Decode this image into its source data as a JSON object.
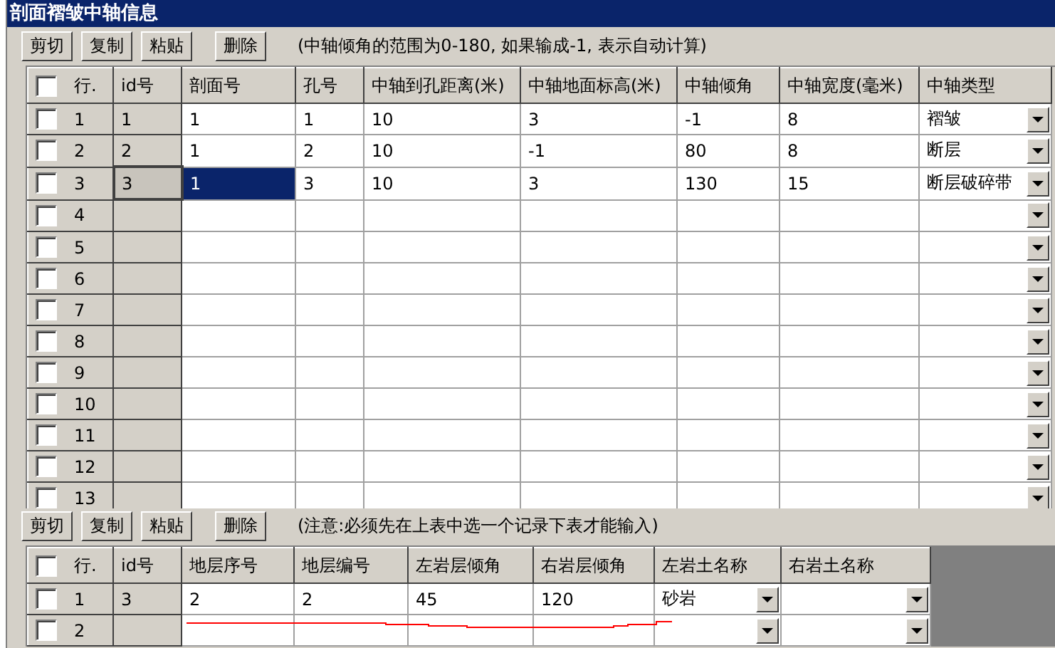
{
  "window": {
    "title": "剖面褶皱中轴信息"
  },
  "toolbar_top": {
    "buttons": [
      "剪切",
      "复制",
      "粘贴",
      "删除"
    ],
    "note": "(中轴倾角的范围为0-180, 如果输成-1, 表示自动计算)"
  },
  "axis_table": {
    "header_checked": false,
    "columns": [
      "行.",
      "id号",
      "剖面号",
      "孔号",
      "中轴到孔距离(米)",
      "中轴地面标高(米)",
      "中轴倾角",
      "中轴宽度(毫米)",
      "中轴类型"
    ],
    "rows": [
      {
        "cells": [
          "1",
          "1",
          "1",
          "1",
          "10",
          "3",
          "-1",
          "8",
          "褶皱"
        ],
        "checked": false,
        "selected": false
      },
      {
        "cells": [
          "2",
          "2",
          "1",
          "2",
          "10",
          "-1",
          "80",
          "8",
          "断层"
        ],
        "checked": false,
        "selected": false
      },
      {
        "cells": [
          "3",
          "3",
          "1",
          "3",
          "10",
          "3",
          "130",
          "15",
          "断层破碎带"
        ],
        "checked": false,
        "selected": true
      },
      {
        "cells": [
          "4",
          "",
          "",
          "",
          "",
          "",
          "",
          "",
          ""
        ],
        "checked": false,
        "selected": false
      },
      {
        "cells": [
          "5",
          "",
          "",
          "",
          "",
          "",
          "",
          "",
          ""
        ],
        "checked": false,
        "selected": false
      },
      {
        "cells": [
          "6",
          "",
          "",
          "",
          "",
          "",
          "",
          "",
          ""
        ],
        "checked": false,
        "selected": false
      },
      {
        "cells": [
          "7",
          "",
          "",
          "",
          "",
          "",
          "",
          "",
          ""
        ],
        "checked": false,
        "selected": false
      },
      {
        "cells": [
          "8",
          "",
          "",
          "",
          "",
          "",
          "",
          "",
          ""
        ],
        "checked": false,
        "selected": false
      },
      {
        "cells": [
          "9",
          "",
          "",
          "",
          "",
          "",
          "",
          "",
          ""
        ],
        "checked": false,
        "selected": false
      },
      {
        "cells": [
          "10",
          "",
          "",
          "",
          "",
          "",
          "",
          "",
          ""
        ],
        "checked": false,
        "selected": false
      },
      {
        "cells": [
          "11",
          "",
          "",
          "",
          "",
          "",
          "",
          "",
          ""
        ],
        "checked": false,
        "selected": false
      },
      {
        "cells": [
          "12",
          "",
          "",
          "",
          "",
          "",
          "",
          "",
          ""
        ],
        "checked": false,
        "selected": false
      },
      {
        "cells": [
          "13",
          "",
          "",
          "",
          "",
          "",
          "",
          "",
          ""
        ],
        "checked": false,
        "selected": false
      }
    ]
  },
  "toolbar_bottom": {
    "buttons": [
      "剪切",
      "复制",
      "粘贴",
      "删除"
    ],
    "note": "(注意:必须先在上表中选一个记录下表才能输入)"
  },
  "layer_table": {
    "header_checked": false,
    "columns": [
      "行.",
      "id号",
      "地层序号",
      "地层编号",
      "左岩层倾角",
      "右岩层倾角",
      "左岩土名称",
      "右岩土名称"
    ],
    "rows": [
      {
        "cells": [
          "1",
          "3",
          "2",
          "2",
          "45",
          "120",
          "砂岩",
          ""
        ],
        "checked": false
      },
      {
        "cells": [
          "2",
          "",
          "",
          "",
          "",
          "",
          "",
          ""
        ],
        "checked": false
      }
    ]
  }
}
